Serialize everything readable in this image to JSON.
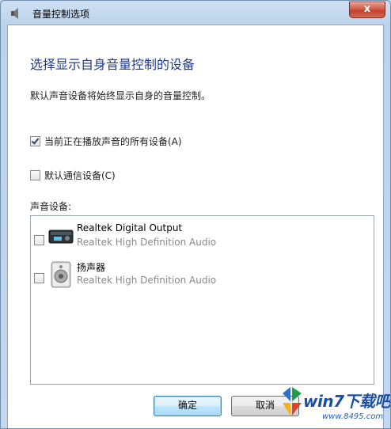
{
  "window": {
    "title": "音量控制选项",
    "close_label": "x"
  },
  "content": {
    "heading": "选择显示自身音量控制的设备",
    "description": "默认声音设备将始终显示自身的音量控制。",
    "options": [
      {
        "label": "当前正在播放声音的所有设备(A)",
        "checked": true
      },
      {
        "label": "默认通信设备(C)",
        "checked": false
      }
    ],
    "list_label": "声音设备:",
    "devices": [
      {
        "name": "Realtek Digital Output",
        "sub": "Realtek High Definition Audio",
        "icon": "digital-output-icon",
        "checked": false
      },
      {
        "name": "扬声器",
        "sub": "Realtek High Definition Audio",
        "icon": "speaker-icon",
        "checked": false
      }
    ]
  },
  "buttons": {
    "ok": "确定",
    "cancel": "取消"
  },
  "watermark": {
    "brand": "win7下载吧",
    "url": "www.8495.com"
  },
  "colors": {
    "heading": "#1f3b8f",
    "close_button": "#c33f2a"
  }
}
